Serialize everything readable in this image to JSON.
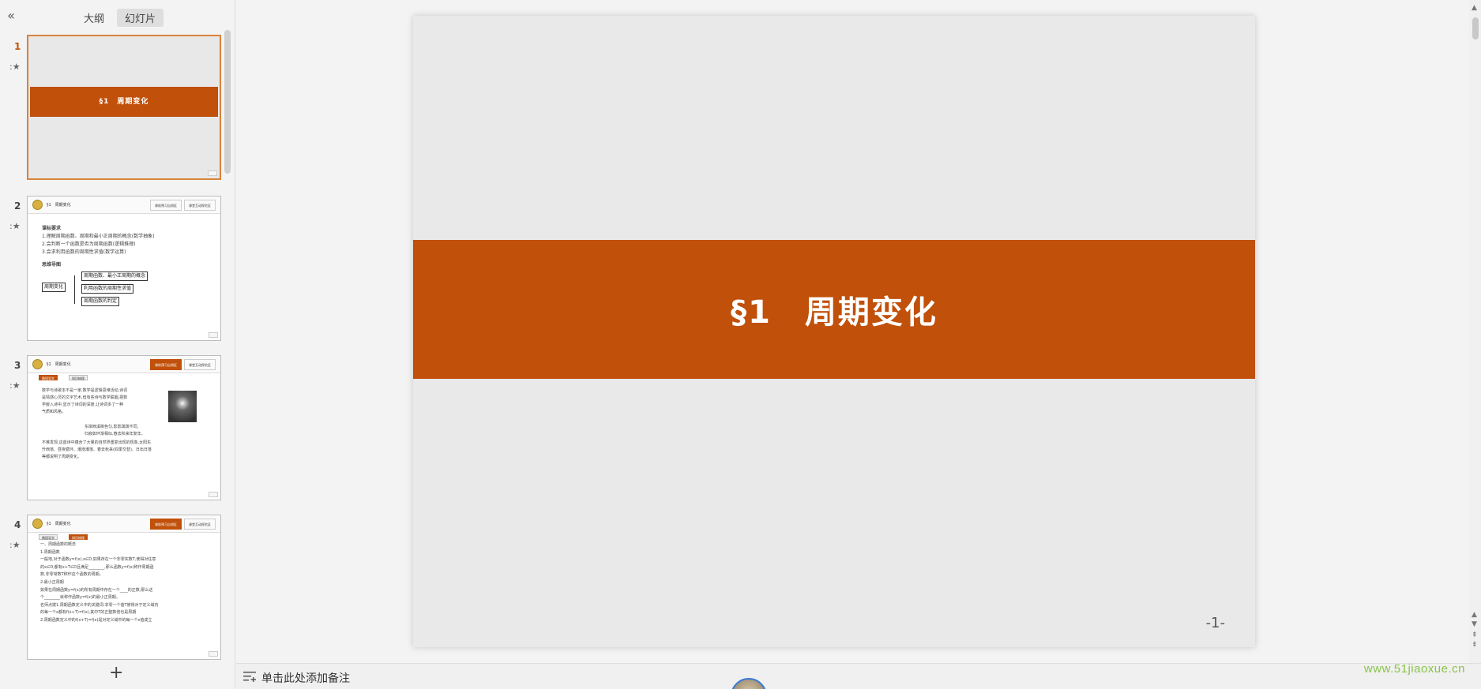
{
  "left_panel": {
    "collapse_icon": "double-chevron-left-icon",
    "tabs": [
      {
        "label": "大纲",
        "active": false
      },
      {
        "label": "幻灯片",
        "active": true
      }
    ],
    "slides": [
      {
        "number": "1",
        "title": "§1　周期变化"
      },
      {
        "number": "2",
        "header_title": "§1　周期变化",
        "header_tabs": [
          "课前预习自测区",
          "课堂互动探究区"
        ],
        "goals_heading": "课标要求",
        "goals": [
          "1.理解周期函数、周期和最小正周期的概念(数学抽象)",
          "2.会判断一个函数是否为周期函数(逻辑推理)",
          "3.会求利用函数的周期性求值(数学运算)"
        ],
        "map_heading": "思维导图",
        "map_root": "周期变化",
        "map_nodes": [
          "周期函数、最小正周期的概念",
          "利用函数的周期性求值",
          "周期函数的判定"
        ]
      },
      {
        "number": "3",
        "header_title": "§1　周期变化",
        "header_tabs": [
          "课前预习自测区",
          "课堂互动探究区"
        ],
        "sub_tabs": [
          "情境导学",
          "知识梳理"
        ],
        "text_a": "数学与诗歌本不是一家,数学是逻辑思维活动,诗词\n是情感心灵的文字艺术,但有些诗与数学联姻,把数\n学嵌入诗中,显示了诗词的深度,让诗词多了一种\n气质和风格。",
        "text_b": "东岸西溪柳色匀,影影疏疏不同,\n归寂如环渐相似,春去秋来年复年。",
        "text_c": "不难发现,这首诗中蕴含了大量的自然界重复出现的现象,太阳东\n升西落、昼夜循环、潮涨潮落、春去秋来(四季交替)、日出日落\n等都说明了周期变化。"
      },
      {
        "number": "4",
        "header_title": "§1　周期变化",
        "header_tabs": [
          "课前预习自测区",
          "课堂互动探究区"
        ],
        "sub_tabs": [
          "情境导学",
          "知识梳理"
        ],
        "text": "一、周期函数的概念\n1.周期函数\n一般地,对于函数y=f(x),x∈D,如果存在一个非零实数T,使得对任意\n的x∈D,都有x+T∈D且满足________,那么函数y=f(x)称作周期函\n数,非零常数T称作这个函数的周期。\n2.最小正周期\n如果在周期函数y=f(x)的所有周期中存在一个____的正数,那么这\n个________就称作函数y=f(x)的最小正周期。\n名师点拨1.周期函数定义中的关键词:非零一个值T使得对于定义域内\n的每一个x都有f(x+T)=f(x),其中T的正整数倍也是周期\n2.周期函数定义中的f(x+T)=f(x)是对定义域中的每一个x值成立"
      }
    ],
    "add_slide_icon": "plus-icon"
  },
  "slide": {
    "title": "§1　周期变化",
    "page_number": "-1-",
    "band_color": "#c0500a",
    "background": "#e9e9e9"
  },
  "notes": {
    "icon": "notes-list-icon",
    "placeholder": "单击此处添加备注"
  },
  "watermark": "www.51jiaoxue.cn"
}
